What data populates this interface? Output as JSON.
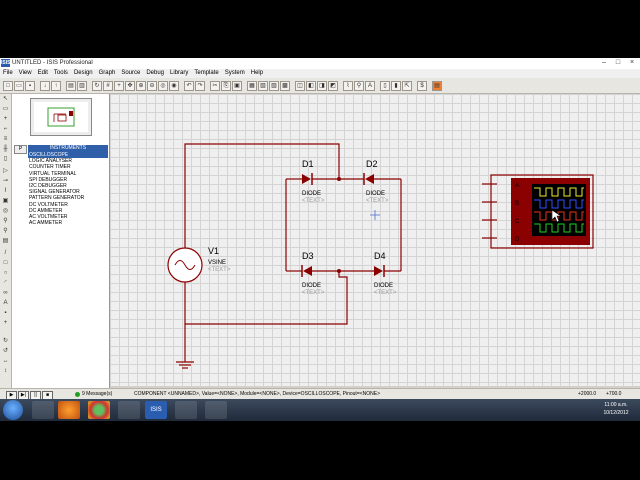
{
  "window": {
    "app_icon": "ISIS",
    "title": "UNTITLED - ISIS Professional"
  },
  "menu": [
    "File",
    "View",
    "Edit",
    "Tools",
    "Design",
    "Graph",
    "Source",
    "Debug",
    "Library",
    "Template",
    "System",
    "Help"
  ],
  "instruments": {
    "header": "INSTRUMENTS",
    "items": [
      "OSCILLOSCOPE",
      "LOGIC ANALYSER",
      "COUNTER TIMER",
      "VIRTUAL TERMINAL",
      "SPI DEBUGGER",
      "I2C DEBUGGER",
      "SIGNAL GENERATOR",
      "PATTERN GENERATOR",
      "DC VOLTMETER",
      "DC AMMETER",
      "AC VOLTMETER",
      "AC AMMETER"
    ],
    "selected_index": 0
  },
  "schematic": {
    "source": {
      "ref": "V1",
      "value": "VSINE",
      "text": "<TEXT>"
    },
    "diodes": [
      {
        "ref": "D1",
        "value": "DIODE",
        "text": "<TEXT>"
      },
      {
        "ref": "D2",
        "value": "DIODE",
        "text": "<TEXT>"
      },
      {
        "ref": "D3",
        "value": "DIODE",
        "text": "<TEXT>"
      },
      {
        "ref": "D4",
        "value": "DIODE",
        "text": "<TEXT>"
      }
    ],
    "scope_channels": [
      "A",
      "B",
      "C",
      "D"
    ],
    "scope_trace_colors": [
      "#e8e830",
      "#3050ff",
      "#e83020",
      "#20d020"
    ],
    "wire_color": "#8b0000",
    "component_color": "#8b0000"
  },
  "status": {
    "messages": "9 Message(s)",
    "text": "COMPONENT <UNNAMED>, Value=<NONE>, Module=<NONE>, Device=OSCILLOSCOPE, Pinout=<NONE>",
    "coord_x": "+2000.0",
    "coord_y": "+700.0"
  },
  "taskbar": {
    "time": "11:00 a.m.",
    "date": "10/12/2012"
  }
}
